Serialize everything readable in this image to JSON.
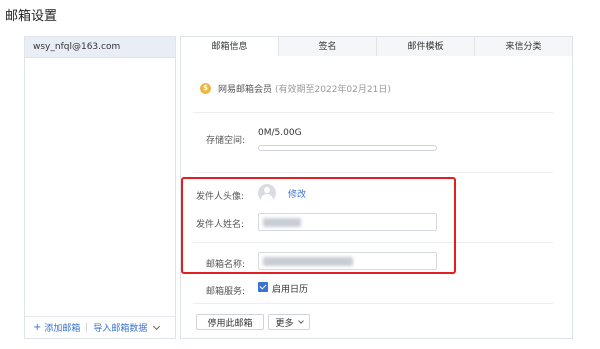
{
  "page": {
    "title": "邮箱设置"
  },
  "account": {
    "email": "wsy_nfql@163.com"
  },
  "footer": {
    "add_label": "添加邮箱",
    "import_label": "导入邮箱数据"
  },
  "tabs": [
    {
      "label": "邮箱信息"
    },
    {
      "label": "签名"
    },
    {
      "label": "邮件模板"
    },
    {
      "label": "来信分类"
    }
  ],
  "vip": {
    "label": "网易邮箱会员",
    "expire": "(有效期至2022年02月21日)"
  },
  "storage": {
    "label": "存储空间:",
    "value": "0M/5.00G",
    "used_fraction": 0.0
  },
  "sender_avatar": {
    "label": "发件人头像:",
    "edit": "修改"
  },
  "sender_name": {
    "label": "发件人姓名:"
  },
  "mailbox_name": {
    "label": "邮箱名称:"
  },
  "mail_service": {
    "label": "邮箱服务:",
    "calendar_label": "启用日历",
    "calendar_enabled": true
  },
  "actions": {
    "disable_label": "停用此邮箱",
    "more_label": "更多"
  }
}
